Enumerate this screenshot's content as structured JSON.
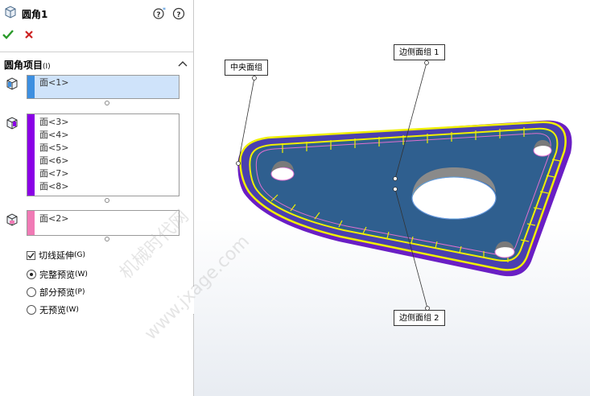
{
  "panel": {
    "title": "圆角1",
    "help_icons": [
      "help-star-icon",
      "help-icon"
    ],
    "section": {
      "label": "圆角项目",
      "hint": "(I)"
    },
    "lists": [
      {
        "items": [
          "面<1>"
        ],
        "color": "#3d8fe0"
      },
      {
        "items": [
          "面<3>",
          "面<4>",
          "面<5>",
          "面<6>",
          "面<7>",
          "面<8>"
        ],
        "color": "#8a00e6"
      },
      {
        "items": [
          "面<2>"
        ],
        "color": "#f07ab5"
      }
    ],
    "tangent": {
      "label": "切线延伸",
      "hint": "(G)",
      "checked": true
    },
    "preview": [
      {
        "label": "完整预览",
        "hint": "(W)",
        "selected": true
      },
      {
        "label": "部分预览",
        "hint": "(P)",
        "selected": false
      },
      {
        "label": "无预览",
        "hint": "(W)",
        "selected": false
      }
    ]
  },
  "viewport": {
    "callouts": {
      "center": "中央面组",
      "side1": "边侧面组 1",
      "side2": "边侧面组 2"
    },
    "watermark": [
      "机械时代网",
      "www.jxage.com"
    ],
    "colors": {
      "face": "#2f5f8f",
      "edge_yellow": "#f0f000",
      "side_purple": "#6a1fc4",
      "hole_pink": "#e06fd0"
    }
  }
}
